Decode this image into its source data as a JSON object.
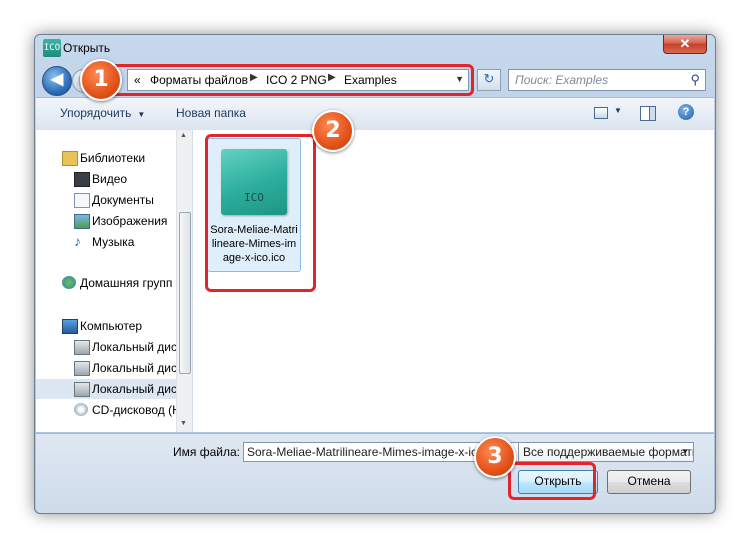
{
  "window": {
    "title": "Открыть",
    "app_icon_text": "ICO",
    "close_symbol": "✕"
  },
  "navigation": {
    "back_symbol": "◀",
    "forward_symbol": "▶",
    "breadcrumb_prefix": "«",
    "breadcrumb": [
      "Форматы файлов",
      "ICO 2 PNG",
      "Examples"
    ],
    "separator": "▶",
    "refresh_symbol": "↻",
    "search_placeholder": "Поиск: Examples"
  },
  "toolbar": {
    "organize": "Упорядочить",
    "new_folder": "Новая папка",
    "help_symbol": "?"
  },
  "sidebar": {
    "items": [
      {
        "label": "Библиотеки",
        "icon": "libraries-icon",
        "selected": false
      },
      {
        "label": "Видео",
        "icon": "video-icon",
        "selected": false
      },
      {
        "label": "Документы",
        "icon": "documents-icon",
        "selected": false
      },
      {
        "label": "Изображения",
        "icon": "pictures-icon",
        "selected": false
      },
      {
        "label": "Музыка",
        "icon": "music-icon",
        "selected": false
      },
      {
        "label": "Домашняя групп",
        "icon": "homegroup-icon",
        "selected": false
      },
      {
        "label": "Компьютер",
        "icon": "computer-icon",
        "selected": false
      },
      {
        "label": "Локальный дис",
        "icon": "local-disk-icon",
        "selected": false
      },
      {
        "label": "Локальный дис",
        "icon": "local-disk-icon",
        "selected": false
      },
      {
        "label": "Локальный дис",
        "icon": "local-disk-icon",
        "selected": true
      },
      {
        "label": "CD-дисковод (H",
        "icon": "cd-drive-icon",
        "selected": false
      }
    ]
  },
  "files": [
    {
      "name": "Sora-Meliae-Matrilineare-Mimes-image-x-ico.ico",
      "thumb_text": "ICO",
      "selected": true
    }
  ],
  "bottom": {
    "filename_label": "Имя файла:",
    "filename_value": "Sora-Meliae-Matrilineare-Mimes-image-x-ico.ico",
    "filter_value": "Все поддерживаемые форматы",
    "open_label": "Открыть",
    "cancel_label": "Отмена"
  },
  "annotations": {
    "step1": "1",
    "step2": "2",
    "step3": "3",
    "highlight_color": "#e0262b"
  }
}
